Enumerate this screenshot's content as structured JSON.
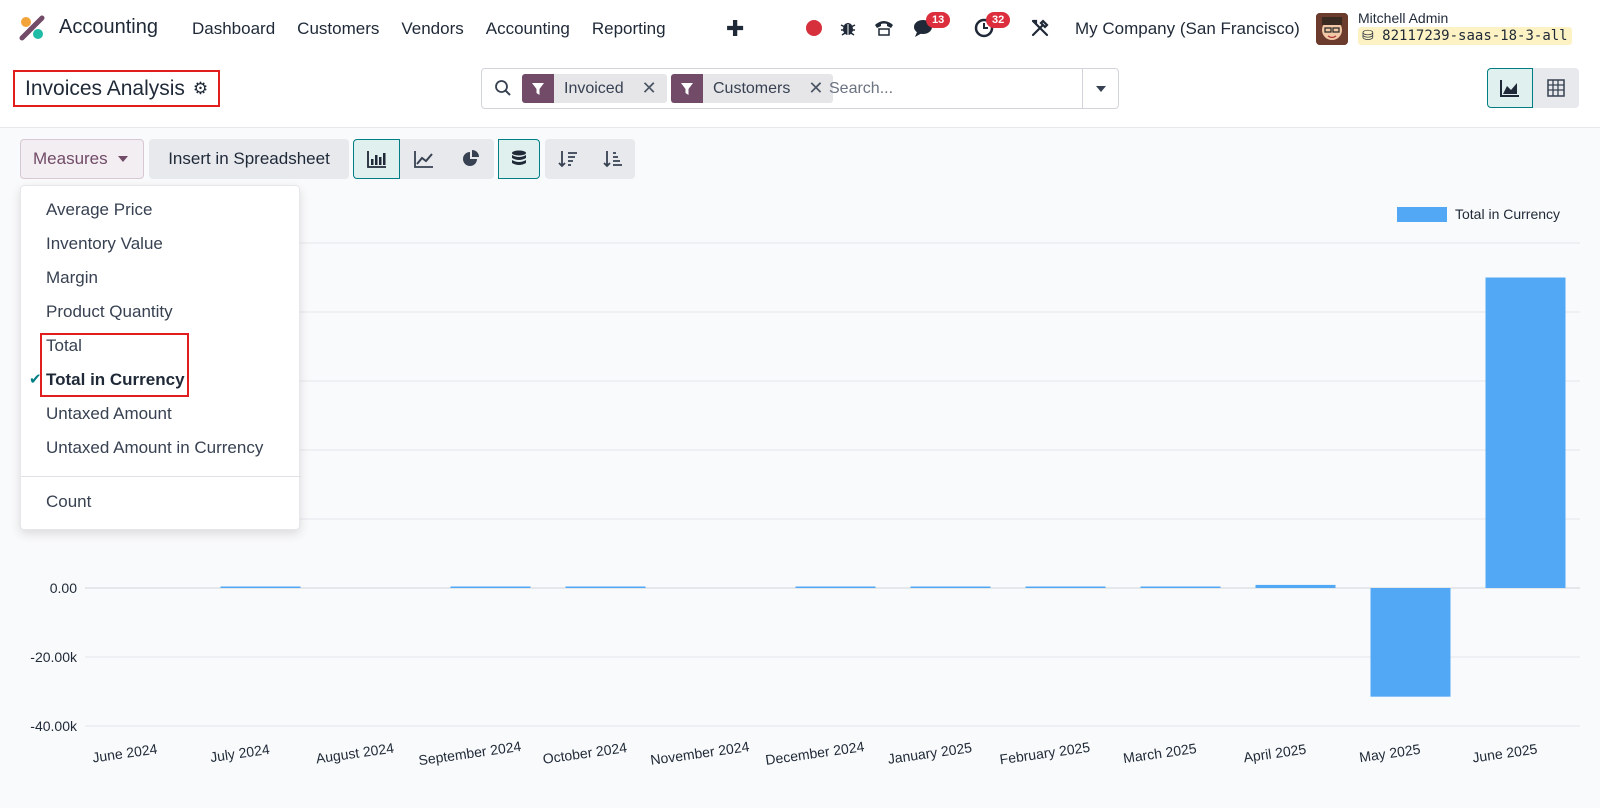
{
  "navbar": {
    "app_name": "Accounting",
    "menu": [
      "Dashboard",
      "Customers",
      "Vendors",
      "Accounting",
      "Reporting"
    ],
    "plus_icon": "plus-icon",
    "messages_count": "13",
    "activities_count": "32",
    "company": "My Company (San Francisco)",
    "user_name": "Mitchell Admin",
    "db_name": "82117239-saas-18-3-all"
  },
  "control_panel": {
    "title": "Invoices Analysis",
    "search": {
      "facets": [
        "Invoiced",
        "Customers"
      ],
      "placeholder": "Search..."
    }
  },
  "toolbar": {
    "measures_label": "Measures",
    "spreadsheet_label": "Insert in Spreadsheet"
  },
  "measures_menu": {
    "items": [
      "Average Price",
      "Inventory Value",
      "Margin",
      "Product Quantity",
      "Total",
      "Total in Currency",
      "Untaxed Amount",
      "Untaxed Amount in Currency"
    ],
    "selected": "Total in Currency",
    "count_label": "Count"
  },
  "colors": {
    "brand": "#714b67",
    "accent": "#017e84",
    "bar": "#52a8f5",
    "badge": "#dc2e3c",
    "highlight": "#e11d1d"
  },
  "chart_data": {
    "type": "bar",
    "categories": [
      "June 2024",
      "July 2024",
      "August 2024",
      "September 2024",
      "October 2024",
      "November 2024",
      "December 2024",
      "January 2025",
      "February 2025",
      "March 2025",
      "April 2025",
      "May 2025",
      "June 2025"
    ],
    "series": [
      {
        "name": "Total in Currency",
        "values": [
          0,
          80,
          0,
          60,
          40,
          0,
          60,
          50,
          60,
          60,
          900,
          -31500,
          90000
        ]
      }
    ],
    "yticks": [
      "-40.00k",
      "-20.00k",
      "0.00"
    ],
    "ylim": [
      -40000,
      100000
    ],
    "legend_position": "top-right",
    "grid": true
  }
}
